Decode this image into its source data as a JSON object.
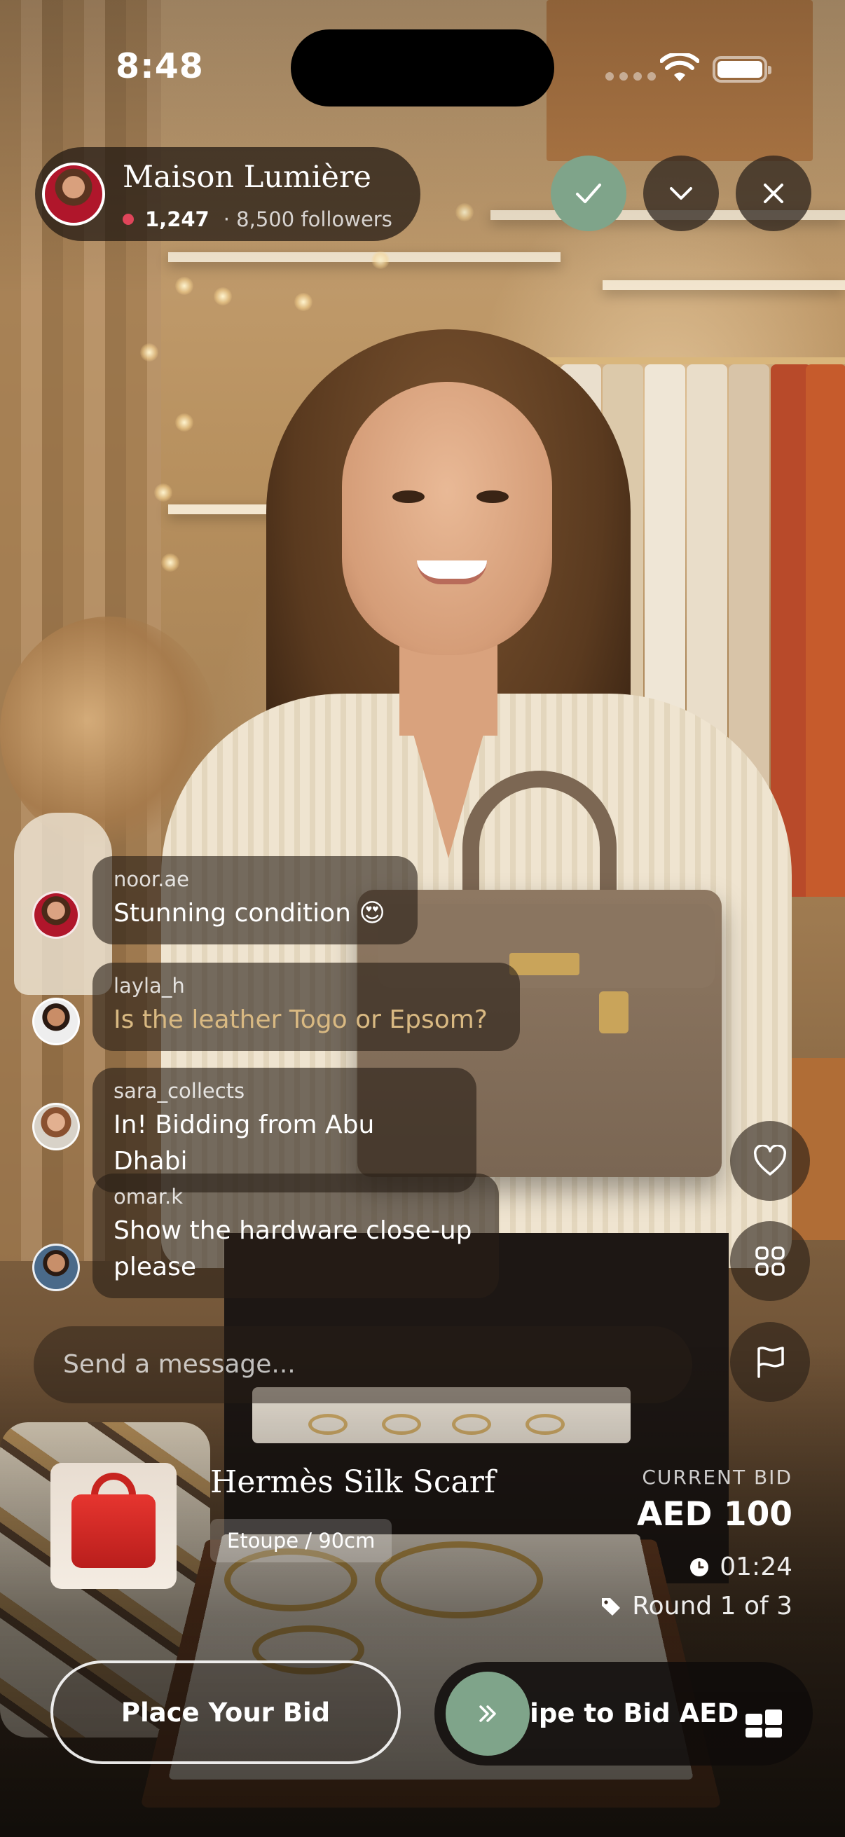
{
  "status_bar": {
    "time": "8:48"
  },
  "host": {
    "name": "Maison Lumière",
    "viewers": "1,247",
    "followers": "· 8,500 followers"
  },
  "header_actions": {
    "check_icon": "checkmark-icon",
    "chevron_icon": "chevron-down-icon",
    "close_icon": "close-icon",
    "accent_color": "#7fa48a"
  },
  "chat": {
    "messages": [
      {
        "user": "noor.ae",
        "text": "Stunning condition 😍",
        "highlight": false
      },
      {
        "user": "layla_h",
        "text": "Is the leather Togo or Epsom?",
        "highlight": true
      },
      {
        "user": "sara_collects",
        "text": "In! Bidding from Abu Dhabi",
        "highlight": false
      },
      {
        "user": "omar.k",
        "text": "Show the hardware close-up please",
        "highlight": false
      }
    ],
    "input_placeholder": "Send a message..."
  },
  "side_actions": [
    "heart-icon",
    "grid-icon",
    "flag-icon"
  ],
  "product": {
    "title": "Hermès Silk Scarf",
    "variant": "Etoupe / 90cm",
    "bid_label": "CURRENT BID",
    "bid_value": "AED 100",
    "timer": "01:24",
    "round": "Round 1 of 3"
  },
  "actions": {
    "place_bid": "Place Your Bid",
    "swipe_label": "wipe to Bid AED"
  }
}
